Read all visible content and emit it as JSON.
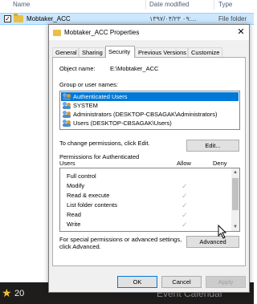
{
  "explorer": {
    "columns": {
      "name": "Name",
      "date": "Date modified",
      "type": "Type"
    },
    "file": {
      "name": "Mobtaker_ACC",
      "date": "۱۳۹۷/۰۴/۲۳ ۰۹:...",
      "type": "File folder",
      "checked": true
    },
    "taskbar": {
      "count": "20",
      "label": "Event Calendar"
    }
  },
  "dialog": {
    "title": "Mobtaker_ACC Properties",
    "close_icon": "close-icon",
    "tabs": [
      "General",
      "Sharing",
      "Security",
      "Previous Versions",
      "Customize"
    ],
    "active_tab": "Security",
    "object_name_label": "Object name:",
    "object_name_value": "E:\\Mobtaker_ACC",
    "group_label": "Group or user names:",
    "groups": [
      "Authenticated Users",
      "SYSTEM",
      "Administrators (DESKTOP-CBSAGAK\\Administrators)",
      "Users (DESKTOP-CBSAGAK\\Users)"
    ],
    "selected_group": "Authenticated Users",
    "change_perm_text": "To change permissions, click Edit.",
    "edit_button": "Edit...",
    "perm_for_label_line1": "Permissions for Authenticated",
    "perm_for_label_line2": "Users",
    "allow_label": "Allow",
    "deny_label": "Deny",
    "permissions": [
      {
        "name": "Full control",
        "allow": false
      },
      {
        "name": "Modify",
        "allow": true
      },
      {
        "name": "Read & execute",
        "allow": true
      },
      {
        "name": "List folder contents",
        "allow": true
      },
      {
        "name": "Read",
        "allow": true
      },
      {
        "name": "Write",
        "allow": true
      }
    ],
    "advanced_text_line1": "For special permissions or advanced settings,",
    "advanced_text_line2": "click Advanced.",
    "advanced_button": "Advanced",
    "ok_button": "OK",
    "cancel_button": "Cancel",
    "apply_button": "Apply",
    "colors": {
      "selection": "#0078d7",
      "folder": "#e9bf48",
      "check_gray": "#b4b4b4"
    }
  }
}
